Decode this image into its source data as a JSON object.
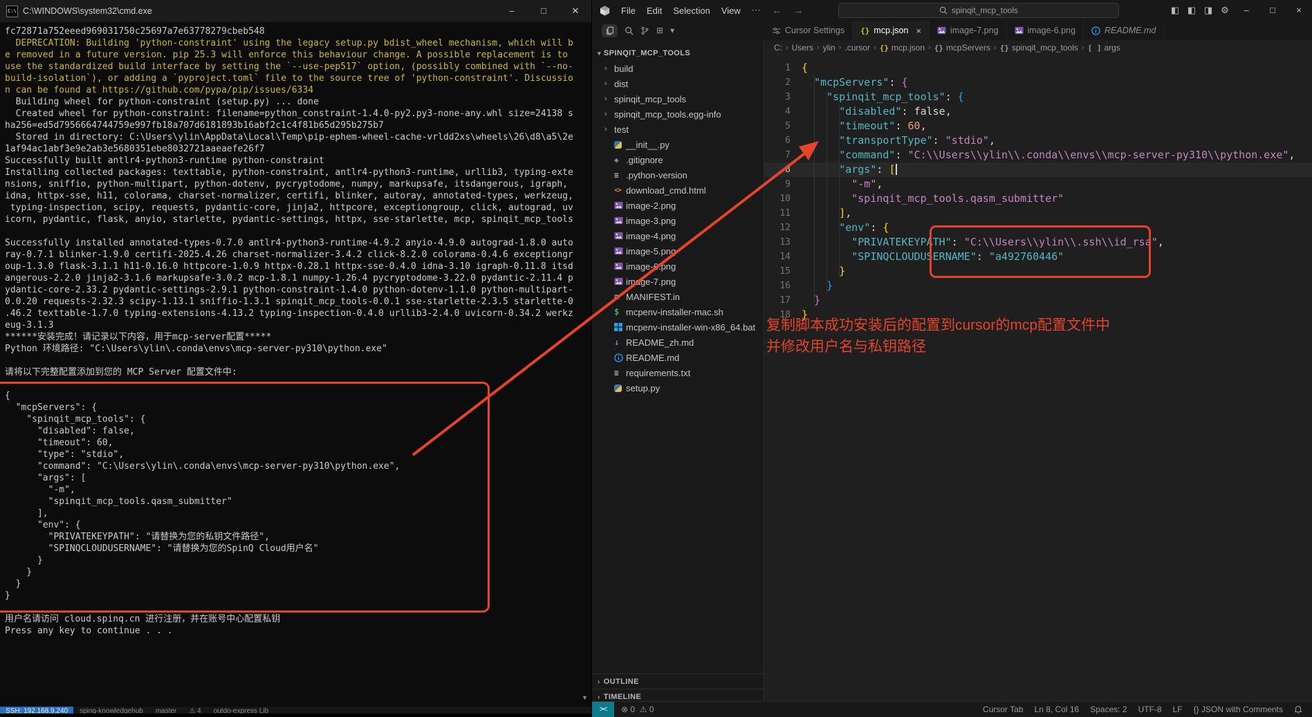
{
  "colors": {
    "annotation_red": "#e5432c",
    "terminal_yellow": "#c9b73b",
    "terminal_text": "#cccccc",
    "syntax_key": "#56b6c2",
    "syntax_string": "#c586c0",
    "syntax_number": "#dca570",
    "bracket_level1": "#ffd700",
    "bracket_level2": "#da70d6",
    "bracket_level3": "#2e9cff",
    "json_tab_icon": "#d8b849",
    "remote_segment": "#0f7b8a",
    "ssh_segment": "#2a6fba"
  },
  "terminal": {
    "title": "C:\\WINDOWS\\system32\\cmd.exe",
    "buttons": {
      "minimize": "–",
      "maximize": "□",
      "close": "✕"
    },
    "lines": [
      {
        "t": "fc72871a752eeed969031750c25697a7e63778279cbeb548"
      },
      {
        "t": "  DEPRECATION: Building 'python-constraint' using the legacy setup.py bdist_wheel mechanism, which will b",
        "c": "y"
      },
      {
        "t": "e removed in a future version. pip 25.3 will enforce this behaviour change. A possible replacement is to",
        "c": "y"
      },
      {
        "t": "use the standardized build interface by setting the `--use-pep517` option, (possibly combined with `--no-",
        "c": "y"
      },
      {
        "t": "build-isolation`), or adding a `pyproject.toml` file to the source tree of 'python-constraint'. Discussio",
        "c": "y"
      },
      {
        "t": "n can be found at https://github.com/pypa/pip/issues/6334",
        "c": "y"
      },
      {
        "t": "  Building wheel for python-constraint (setup.py) ... done"
      },
      {
        "t": "  Created wheel for python-constraint: filename=python_constraint-1.4.0-py2.py3-none-any.whl size=24138 s"
      },
      {
        "t": "ha256=ed5d7956664744759e997fb18a707d6181893b16abf2c1c4f81b65d295b275b7"
      },
      {
        "t": "  Stored in directory: C:\\Users\\ylin\\AppData\\Local\\Temp\\pip-ephem-wheel-cache-vrldd2xs\\wheels\\26\\d8\\a5\\2e"
      },
      {
        "t": "1af94ac1abf3e9e2ab3e5680351ebe8032721aaeaefe26f7"
      },
      {
        "t": "Successfully built antlr4-python3-runtime python-constraint"
      },
      {
        "t": "Installing collected packages: texttable, python-constraint, antlr4-python3-runtime, urllib3, typing-exte"
      },
      {
        "t": "nsions, sniffio, python-multipart, python-dotenv, pycryptodome, numpy, markupsafe, itsdangerous, igraph,"
      },
      {
        "t": "idna, httpx-sse, h11, colorama, charset-normalizer, certifi, blinker, autoray, annotated-types, werkzeug,"
      },
      {
        "t": " typing-inspection, scipy, requests, pydantic-core, jinja2, httpcore, exceptiongroup, click, autograd, uv"
      },
      {
        "t": "icorn, pydantic, flask, anyio, starlette, pydantic-settings, httpx, sse-starlette, mcp, spinqit_mcp_tools"
      },
      {
        "t": ""
      },
      {
        "t": "Successfully installed annotated-types-0.7.0 antlr4-python3-runtime-4.9.2 anyio-4.9.0 autograd-1.8.0 auto"
      },
      {
        "t": "ray-0.7.1 blinker-1.9.0 certifi-2025.4.26 charset-normalizer-3.4.2 click-8.2.0 colorama-0.4.6 exceptiongr"
      },
      {
        "t": "oup-1.3.0 flask-3.1.1 h11-0.16.0 httpcore-1.0.9 httpx-0.28.1 httpx-sse-0.4.0 idna-3.10 igraph-0.11.8 itsd"
      },
      {
        "t": "angerous-2.2.0 jinja2-3.1.6 markupsafe-3.0.2 mcp-1.8.1 numpy-1.26.4 pycryptodome-3.22.0 pydantic-2.11.4 p"
      },
      {
        "t": "ydantic-core-2.33.2 pydantic-settings-2.9.1 python-constraint-1.4.0 python-dotenv-1.1.0 python-multipart-"
      },
      {
        "t": "0.0.20 requests-2.32.3 scipy-1.13.1 sniffio-1.3.1 spinqit_mcp_tools-0.0.1 sse-starlette-2.3.5 starlette-0"
      },
      {
        "t": ".46.2 texttable-1.7.0 typing-extensions-4.13.2 typing-inspection-0.4.0 urllib3-2.4.0 uvicorn-0.34.2 werkz"
      },
      {
        "t": "eug-3.1.3"
      },
      {
        "t": "******安装完成！请记录以下内容，用于mcp-server配置*****"
      },
      {
        "t": "Python 环境路径: \"C:\\Users\\ylin\\.conda\\envs\\mcp-server-py310\\python.exe\""
      },
      {
        "t": ""
      },
      {
        "t": "请将以下完整配置添加到您的 MCP Server 配置文件中:"
      },
      {
        "t": ""
      },
      {
        "t": "{"
      },
      {
        "t": "  \"mcpServers\": {"
      },
      {
        "t": "    \"spinqit_mcp_tools\": {"
      },
      {
        "t": "      \"disabled\": false,"
      },
      {
        "t": "      \"timeout\": 60,"
      },
      {
        "t": "      \"type\": \"stdio\","
      },
      {
        "t": "      \"command\": \"C:\\Users\\ylin\\.conda\\envs\\mcp-server-py310\\python.exe\","
      },
      {
        "t": "      \"args\": ["
      },
      {
        "t": "        \"-m\","
      },
      {
        "t": "        \"spinqit_mcp_tools.qasm_submitter\""
      },
      {
        "t": "      ],"
      },
      {
        "t": "      \"env\": {"
      },
      {
        "t": "        \"PRIVATEKEYPATH\": \"请替换为您的私钥文件路径\","
      },
      {
        "t": "        \"SPINQCLOUDUSERNAME\": \"请替换为您的SpinQ Cloud用户名\""
      },
      {
        "t": "      }"
      },
      {
        "t": "    }"
      },
      {
        "t": "  }"
      },
      {
        "t": "}"
      },
      {
        "t": ""
      },
      {
        "t": "用户名请访问 cloud.spinq.cn 进行注册，并在账号中心配置私钥"
      },
      {
        "t": "Press any key to continue . . ."
      }
    ]
  },
  "background_strip": {
    "ssh": "SSH: 192.168.9.240",
    "segments": [
      "spinq-knowledgehub",
      "master",
      "⚠ 4",
      "outdo-express Lib"
    ]
  },
  "vscode": {
    "menus": [
      "File",
      "Edit",
      "Selection",
      "View"
    ],
    "menu_overflow": "⋯",
    "search_value": "spinqit_mcp_tools",
    "window_buttons": {
      "minimize": "–",
      "maximize": "□",
      "close": "×"
    },
    "tabs": [
      {
        "icon": "sliders",
        "label": "Cursor Settings",
        "active": false,
        "italic": false,
        "closable": false
      },
      {
        "icon": "braces-yellow",
        "label": "mcp.json",
        "active": true,
        "italic": false,
        "closable": true
      },
      {
        "icon": "image",
        "label": "image-7.png",
        "active": false,
        "italic": false,
        "closable": false
      },
      {
        "icon": "image",
        "label": "image-6.png",
        "active": false,
        "italic": false,
        "closable": false
      },
      {
        "icon": "info",
        "label": "README.md",
        "active": false,
        "italic": true,
        "closable": false
      }
    ],
    "tabbar_actions": [
      "◫",
      "⋯"
    ],
    "breadcrumbs": [
      {
        "label": "C:"
      },
      {
        "label": "Users"
      },
      {
        "label": "ylin"
      },
      {
        "label": ".cursor"
      },
      {
        "icon": "braces-yellow",
        "label": "mcp.json"
      },
      {
        "icon": "braces",
        "label": "mcpServers"
      },
      {
        "icon": "braces",
        "label": "spinqit_mcp_tools"
      },
      {
        "icon": "brackets",
        "label": "args"
      }
    ],
    "explorer": {
      "header": "SPINQIT_MCP_TOOLS",
      "items": [
        {
          "label": "build",
          "type": "folder"
        },
        {
          "label": "dist",
          "type": "folder"
        },
        {
          "label": "spinqit_mcp_tools",
          "type": "folder"
        },
        {
          "label": "spinqit_mcp_tools.egg-info",
          "type": "folder"
        },
        {
          "label": "test",
          "type": "folder"
        },
        {
          "label": "__init__.py",
          "type": "py"
        },
        {
          "label": ".gitignore",
          "type": "git"
        },
        {
          "label": ".python-version",
          "type": "list"
        },
        {
          "label": "download_cmd.html",
          "type": "html"
        },
        {
          "label": "image-2.png",
          "type": "image"
        },
        {
          "label": "image-3.png",
          "type": "image"
        },
        {
          "label": "image-4.png",
          "type": "image"
        },
        {
          "label": "image-5.png",
          "type": "image"
        },
        {
          "label": "image-6.png",
          "type": "image"
        },
        {
          "label": "image-7.png",
          "type": "image"
        },
        {
          "label": "MANIFEST.in",
          "type": "list"
        },
        {
          "label": "mcpenv-installer-mac.sh",
          "type": "shell"
        },
        {
          "label": "mcpenv-installer-win-x86_64.bat",
          "type": "windows"
        },
        {
          "label": "README_zh.md",
          "type": "md-down"
        },
        {
          "label": "README.md",
          "type": "info"
        },
        {
          "label": "requirements.txt",
          "type": "list"
        },
        {
          "label": "setup.py",
          "type": "py"
        }
      ],
      "outline_label": "OUTLINE",
      "timeline_label": "TIMELINE"
    },
    "editor": {
      "lines": [
        {
          "n": 1,
          "segs": [
            {
              "t": "{",
              "c": "b1"
            }
          ]
        },
        {
          "n": 2,
          "segs": [
            {
              "t": "  "
            },
            {
              "t": "\"mcpServers\"",
              "c": "key"
            },
            {
              "t": ": ",
              "c": "pun"
            },
            {
              "t": "{",
              "c": "b2"
            }
          ]
        },
        {
          "n": 3,
          "segs": [
            {
              "t": "    "
            },
            {
              "t": "\"spinqit_mcp_tools\"",
              "c": "key"
            },
            {
              "t": ": ",
              "c": "pun"
            },
            {
              "t": "{",
              "c": "b3"
            }
          ]
        },
        {
          "n": 4,
          "segs": [
            {
              "t": "      "
            },
            {
              "t": "\"disabled\"",
              "c": "key"
            },
            {
              "t": ": ",
              "c": "pun"
            },
            {
              "t": "false",
              "c": "kw"
            },
            {
              "t": ",",
              "c": "pun"
            }
          ]
        },
        {
          "n": 5,
          "segs": [
            {
              "t": "      "
            },
            {
              "t": "\"timeout\"",
              "c": "key"
            },
            {
              "t": ": ",
              "c": "pun"
            },
            {
              "t": "60",
              "c": "num"
            },
            {
              "t": ",",
              "c": "pun"
            }
          ]
        },
        {
          "n": 6,
          "segs": [
            {
              "t": "      "
            },
            {
              "t": "\"transportType\"",
              "c": "key"
            },
            {
              "t": ": ",
              "c": "pun"
            },
            {
              "t": "\"stdio\"",
              "c": "str"
            },
            {
              "t": ",",
              "c": "pun"
            }
          ]
        },
        {
          "n": 7,
          "segs": [
            {
              "t": "      "
            },
            {
              "t": "\"command\"",
              "c": "key"
            },
            {
              "t": ": ",
              "c": "pun"
            },
            {
              "t": "\"C:\\\\Users\\\\ylin\\\\.conda\\\\envs\\\\mcp-server-py310\\\\python.exe\"",
              "c": "str"
            },
            {
              "t": ",",
              "c": "pun"
            }
          ]
        },
        {
          "n": 8,
          "active": true,
          "caret": true,
          "segs": [
            {
              "t": "      "
            },
            {
              "t": "\"args\"",
              "c": "key"
            },
            {
              "t": ": ",
              "c": "pun"
            },
            {
              "t": "[",
              "c": "b1"
            }
          ]
        },
        {
          "n": 9,
          "segs": [
            {
              "t": "        "
            },
            {
              "t": "\"-m\"",
              "c": "str"
            },
            {
              "t": ",",
              "c": "pun"
            }
          ]
        },
        {
          "n": 10,
          "segs": [
            {
              "t": "        "
            },
            {
              "t": "\"spinqit_mcp_tools.qasm_submitter\"",
              "c": "str"
            }
          ]
        },
        {
          "n": 11,
          "segs": [
            {
              "t": "      "
            },
            {
              "t": "]",
              "c": "b1"
            },
            {
              "t": ",",
              "c": "pun"
            }
          ]
        },
        {
          "n": 12,
          "segs": [
            {
              "t": "      "
            },
            {
              "t": "\"env\"",
              "c": "key"
            },
            {
              "t": ": ",
              "c": "pun"
            },
            {
              "t": "{",
              "c": "b1"
            }
          ]
        },
        {
          "n": 13,
          "segs": [
            {
              "t": "        "
            },
            {
              "t": "\"PRIVATEKEYPATH\"",
              "c": "key"
            },
            {
              "t": ": ",
              "c": "pun"
            },
            {
              "t": "\"C:\\\\Users\\\\ylin\\\\.ssh\\\\id_rsa\"",
              "c": "str"
            },
            {
              "t": ",",
              "c": "pun"
            }
          ]
        },
        {
          "n": 14,
          "segs": [
            {
              "t": "        "
            },
            {
              "t": "\"SPINQCLOUDUSERNAME\"",
              "c": "key"
            },
            {
              "t": ": ",
              "c": "pun"
            },
            {
              "t": "\"a492760446\"",
              "c": "key"
            }
          ]
        },
        {
          "n": 15,
          "segs": [
            {
              "t": "      "
            },
            {
              "t": "}",
              "c": "b1"
            }
          ]
        },
        {
          "n": 16,
          "segs": [
            {
              "t": "    "
            },
            {
              "t": "}",
              "c": "b3"
            }
          ]
        },
        {
          "n": 17,
          "segs": [
            {
              "t": "  "
            },
            {
              "t": "}",
              "c": "b2"
            }
          ]
        },
        {
          "n": 18,
          "segs": [
            {
              "t": "}",
              "c": "b1"
            }
          ]
        }
      ]
    },
    "status": {
      "remote_icon": "><",
      "errors": "0",
      "warnings": "0",
      "right_items": [
        "Cursor Tab",
        "Ln 8, Col 16",
        "Spaces: 2",
        "UTF-8",
        "LF",
        "{} JSON with Comments"
      ]
    }
  },
  "annotations": {
    "note_line1": "复制脚本成功安装后的配置到cursor的mcp配置文件中",
    "note_line2": "并修改用户名与私钥路径"
  }
}
